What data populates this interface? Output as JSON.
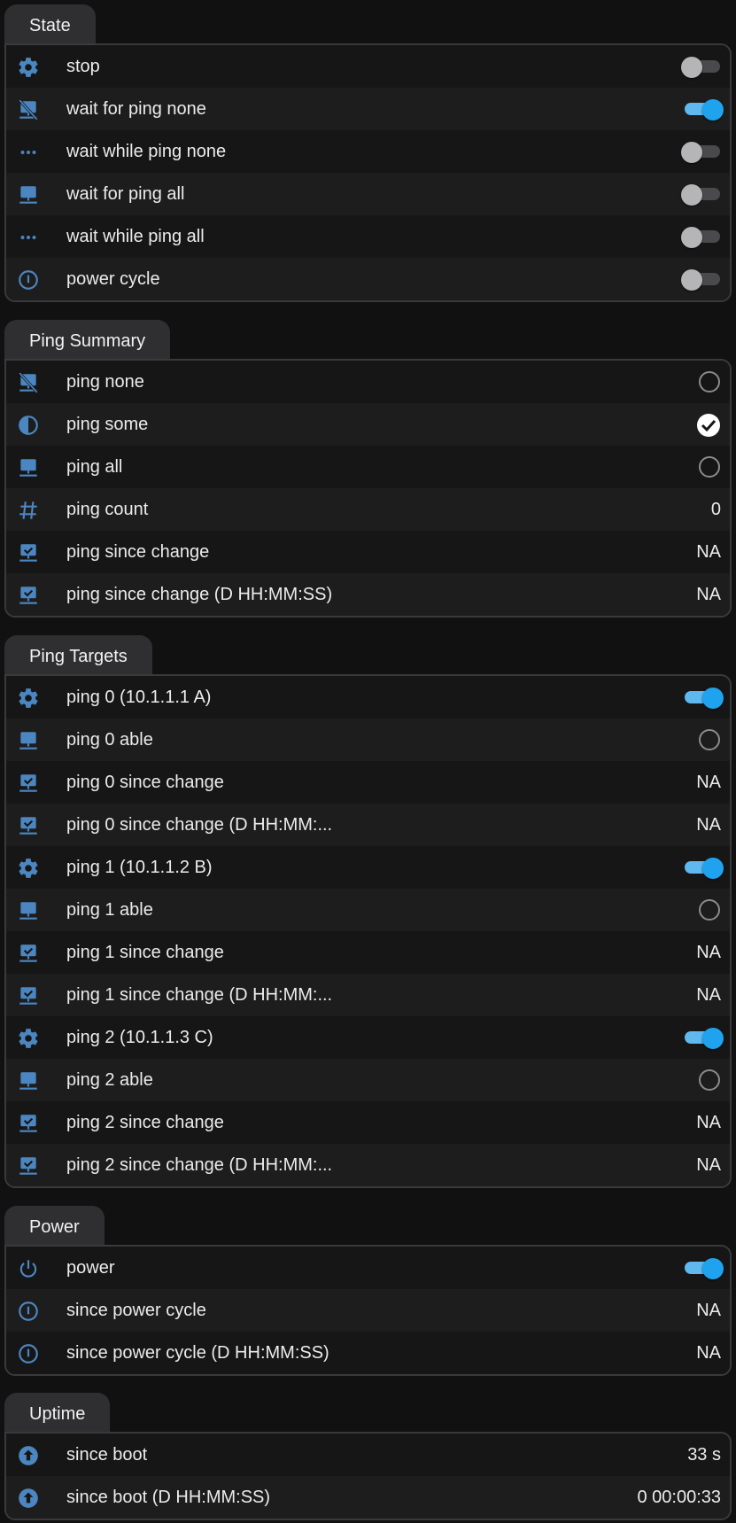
{
  "colors": {
    "background": "#111112",
    "tab": "#2f2f31",
    "icon": "#4c86c0",
    "toggle_on": "#1fa3ef"
  },
  "state": {
    "title": "State",
    "rows": [
      {
        "label": "stop",
        "icon": "gear-icon",
        "control": "toggle",
        "on": false
      },
      {
        "label": "wait for ping none",
        "icon": "monitor-off-icon",
        "control": "toggle",
        "on": true
      },
      {
        "label": "wait while ping none",
        "icon": "dots-icon",
        "control": "toggle",
        "on": false
      },
      {
        "label": "wait for ping all",
        "icon": "monitor-icon",
        "control": "toggle",
        "on": false
      },
      {
        "label": "wait while ping all",
        "icon": "dots-icon",
        "control": "toggle",
        "on": false
      },
      {
        "label": "power cycle",
        "icon": "power-cycle-icon",
        "control": "toggle",
        "on": false
      }
    ]
  },
  "ping_summary": {
    "title": "Ping Summary",
    "rows": [
      {
        "label": "ping none",
        "icon": "monitor-off-icon",
        "control": "radio",
        "checked": false
      },
      {
        "label": "ping some",
        "icon": "half-circle-icon",
        "control": "radio",
        "checked": true
      },
      {
        "label": "ping all",
        "icon": "monitor-icon",
        "control": "radio",
        "checked": false
      },
      {
        "label": "ping count",
        "icon": "pound-icon",
        "value": "0"
      },
      {
        "label": "ping since change",
        "icon": "monitor-check-icon",
        "value": "NA"
      },
      {
        "label": "ping since change (D HH:MM:SS)",
        "icon": "monitor-check-icon",
        "value": "NA"
      }
    ]
  },
  "ping_targets": {
    "title": "Ping Targets",
    "rows": [
      {
        "label": "ping 0 (10.1.1.1 A)",
        "icon": "gear-icon",
        "control": "toggle",
        "on": true
      },
      {
        "label": "ping 0 able",
        "icon": "monitor-icon",
        "control": "radio",
        "checked": false
      },
      {
        "label": "ping 0 since change",
        "icon": "monitor-check-icon",
        "value": "NA"
      },
      {
        "label": "ping 0 since change (D HH:MM:...",
        "icon": "monitor-check-icon",
        "value": "NA"
      },
      {
        "label": "ping 1 (10.1.1.2 B)",
        "icon": "gear-icon",
        "control": "toggle",
        "on": true
      },
      {
        "label": "ping 1 able",
        "icon": "monitor-icon",
        "control": "radio",
        "checked": false
      },
      {
        "label": "ping 1 since change",
        "icon": "monitor-check-icon",
        "value": "NA"
      },
      {
        "label": "ping 1 since change (D HH:MM:...",
        "icon": "monitor-check-icon",
        "value": "NA"
      },
      {
        "label": "ping 2 (10.1.1.3 C)",
        "icon": "gear-icon",
        "control": "toggle",
        "on": true
      },
      {
        "label": "ping 2 able",
        "icon": "monitor-icon",
        "control": "radio",
        "checked": false
      },
      {
        "label": "ping 2 since change",
        "icon": "monitor-check-icon",
        "value": "NA"
      },
      {
        "label": "ping 2 since change (D HH:MM:...",
        "icon": "monitor-check-icon",
        "value": "NA"
      }
    ]
  },
  "power": {
    "title": "Power",
    "rows": [
      {
        "label": "power",
        "icon": "power-icon",
        "control": "toggle",
        "on": true
      },
      {
        "label": "since power cycle",
        "icon": "power-cycle-icon",
        "value": "NA"
      },
      {
        "label": "since power cycle (D HH:MM:SS)",
        "icon": "power-cycle-icon",
        "value": "NA"
      }
    ]
  },
  "uptime": {
    "title": "Uptime",
    "rows": [
      {
        "label": "since boot",
        "icon": "arrow-up-circle-icon",
        "value": "33 s"
      },
      {
        "label": "since boot (D HH:MM:SS)",
        "icon": "arrow-up-circle-icon",
        "value": "0 00:00:33"
      }
    ]
  }
}
